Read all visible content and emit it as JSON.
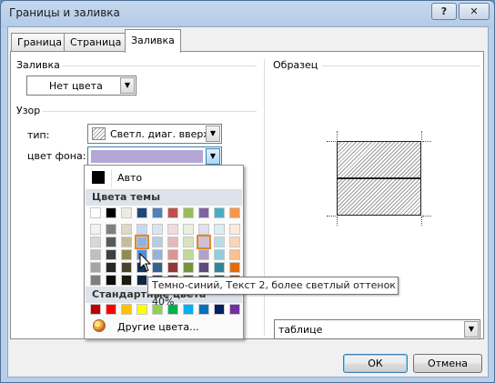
{
  "window": {
    "title": "Границы и заливка",
    "help_label": "?",
    "close_label": "✕"
  },
  "tabs": [
    {
      "label": "Граница"
    },
    {
      "label": "Страница"
    },
    {
      "label": "Заливка"
    }
  ],
  "fill": {
    "group_label": "Заливка",
    "value": "Нет цвета"
  },
  "pattern": {
    "group_label": "Узор",
    "type_label": "тип:",
    "type_value": "Светл. диаг. вверх",
    "bg_label": "цвет фона:",
    "bg_color": "#b4a7d6"
  },
  "preview": {
    "group_label": "Образец",
    "apply_value": "таблице"
  },
  "palette": {
    "auto_label": "Авто",
    "theme_header": "Цвета темы",
    "theme_top": [
      "#ffffff",
      "#000000",
      "#eeece1",
      "#1f497d",
      "#4f81bd",
      "#c0504d",
      "#9bbb59",
      "#8064a2",
      "#4bacc6",
      "#f79646"
    ],
    "theme_shades": [
      [
        "#f2f2f2",
        "#7f7f7f",
        "#ddd9c3",
        "#c6d9f0",
        "#dbe5f1",
        "#f2dcdb",
        "#ebf1dd",
        "#e5e0ec",
        "#dbeef3",
        "#fdeada"
      ],
      [
        "#d8d8d8",
        "#595959",
        "#c4bd97",
        "#8db3e2",
        "#b8cce4",
        "#e5b9b7",
        "#d7e3bc",
        "#ccc1d9",
        "#b7dde8",
        "#fbd5b5"
      ],
      [
        "#bfbfbf",
        "#3f3f3f",
        "#938953",
        "#548dd4",
        "#95b3d7",
        "#d99694",
        "#c3d69b",
        "#b2a2c7",
        "#92cddc",
        "#fac08f"
      ],
      [
        "#a5a5a5",
        "#262626",
        "#494429",
        "#17365d",
        "#366092",
        "#953734",
        "#76923c",
        "#5f497a",
        "#31859b",
        "#e36c09"
      ],
      [
        "#7f7f7f",
        "#0c0c0c",
        "#1d1b10",
        "#0f243e",
        "#244061",
        "#632423",
        "#4f6128",
        "#3f3151",
        "#205867",
        "#974806"
      ]
    ],
    "standard_header": "Стандартные цвета",
    "standard": [
      "#c00000",
      "#ff0000",
      "#ffc000",
      "#ffff00",
      "#92d050",
      "#00b050",
      "#00b0f0",
      "#0070c0",
      "#002060",
      "#7030a0"
    ],
    "more_label": "Другие цвета...",
    "tooltip": "Темно-синий, Текст 2, более светлый оттенок 40%"
  },
  "buttons": {
    "ok": "ОК",
    "cancel": "Отмена"
  }
}
